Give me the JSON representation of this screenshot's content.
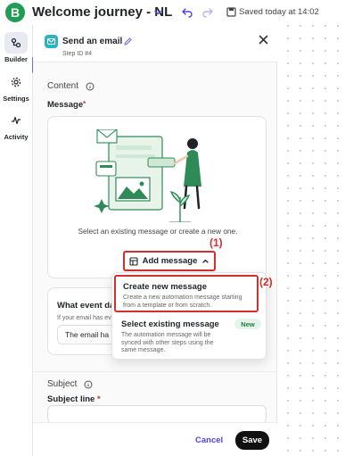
{
  "app": {
    "logo_letter": "B",
    "journey_title": "Welcome journey - NL",
    "saved_status": "Saved today at 14:02"
  },
  "rail": {
    "items": [
      {
        "label": "Builder",
        "icon": "builder-icon",
        "active": true
      },
      {
        "label": "Settings",
        "icon": "gear-icon",
        "active": false
      },
      {
        "label": "Activity",
        "icon": "activity-icon",
        "active": false
      }
    ]
  },
  "panel": {
    "title": "Send an email",
    "step_id": "Step ID #4",
    "content_section": "Content",
    "message_label": "Message",
    "message_required": "*",
    "message_help": "Select an existing message or create a new one.",
    "add_message_label": "Add message",
    "annotation_1": "(1)",
    "event_title": "What event da",
    "event_help": "If your email has ev",
    "event_value": "The email ha",
    "subject_section": "Subject",
    "subject_line_label": "Subject line",
    "subject_required": "*",
    "cancel_label": "Cancel",
    "save_label": "Save"
  },
  "dropdown": {
    "annotation_2": "(2)",
    "options": [
      {
        "title": "Create new message",
        "desc_line1": "Create a new automation message starting",
        "desc_line2": "from a template or from scratch."
      },
      {
        "title": "Select existing message",
        "badge": "New",
        "desc_line1": "The automation message will be",
        "desc_line2": "synced with other steps using the",
        "desc_line3": "same message."
      }
    ]
  },
  "colors": {
    "brand_green": "#1f9d55",
    "accent_purple": "#7b61ff",
    "highlight_red": "#d62d2d",
    "link_indigo": "#4f46e5",
    "illustration_green": "#2e8b57"
  }
}
